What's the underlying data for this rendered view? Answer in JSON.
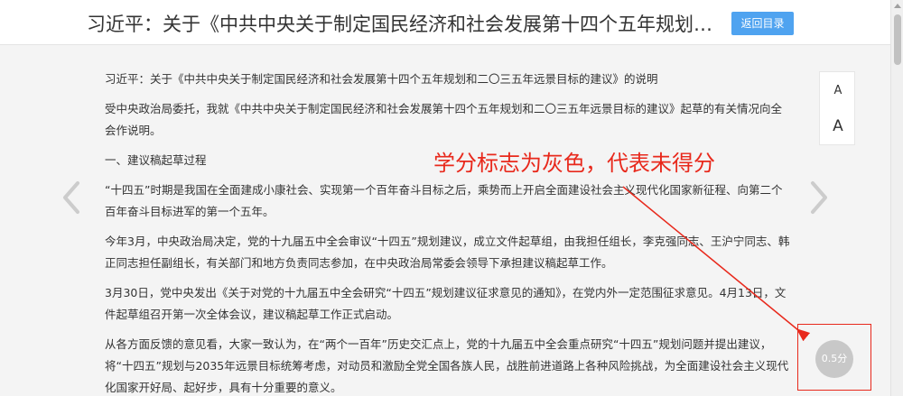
{
  "header": {
    "title": "习近平：关于《中共中央关于制定国民经济和社会发展第十四个五年规划和二〇三五年远景目标的建议》的说明",
    "back_label": "返回目录"
  },
  "font_controls": {
    "small_label": "A",
    "large_label": "A"
  },
  "article": {
    "paragraphs": [
      "习近平：关于《中共中央关于制定国民经济和社会发展第十四个五年规划和二〇三五年远景目标的建议》的说明",
      "受中央政治局委托，我就《中共中央关于制定国民经济和社会发展第十四个五年规划和二〇三五年远景目标的建议》起草的有关情况向全会作说明。",
      "一、建议稿起草过程",
      "“十四五”时期是我国在全面建成小康社会、实现第一个百年奋斗目标之后，乘势而上开启全面建设社会主义现代化国家新征程、向第二个百年奋斗目标进军的第一个五年。",
      "今年3月，中央政治局决定，党的十九届五中全会审议“十四五”规划建议，成立文件起草组，由我担任组长，李克强同志、王沪宁同志、韩正同志担任副组长，有关部门和地方负责同志参加，在中央政治局常委会领导下承担建议稿起草工作。",
      "3月30日，党中央发出《关于对党的十九届五中全会研究“十四五”规划建议征求意见的通知》，在党内外一定范围征求意见。4月13日，文件起草组召开第一次全体会议，建议稿起草工作正式启动。",
      "从各方面反馈的意见看，大家一致认为，在“两个一百年”历史交汇点上，党的十九届五中全会重点研究“十四五”规划问题并提出建议，将“十四五”规划与2035年远景目标统筹考虑，对动员和激励全党全国各族人民，战胜前进道路上各种风险挑战，为全面建设社会主义现代化国家开好局、起好步，具有十分重要的意义。"
    ]
  },
  "annotation": {
    "text": "学分标志为灰色，代表未得分",
    "color": "#e8291c"
  },
  "score": {
    "label": "0.5分",
    "badge_color": "#c8c8c8"
  },
  "icons": {
    "prev": "chevron-left-icon",
    "next": "chevron-right-icon"
  }
}
